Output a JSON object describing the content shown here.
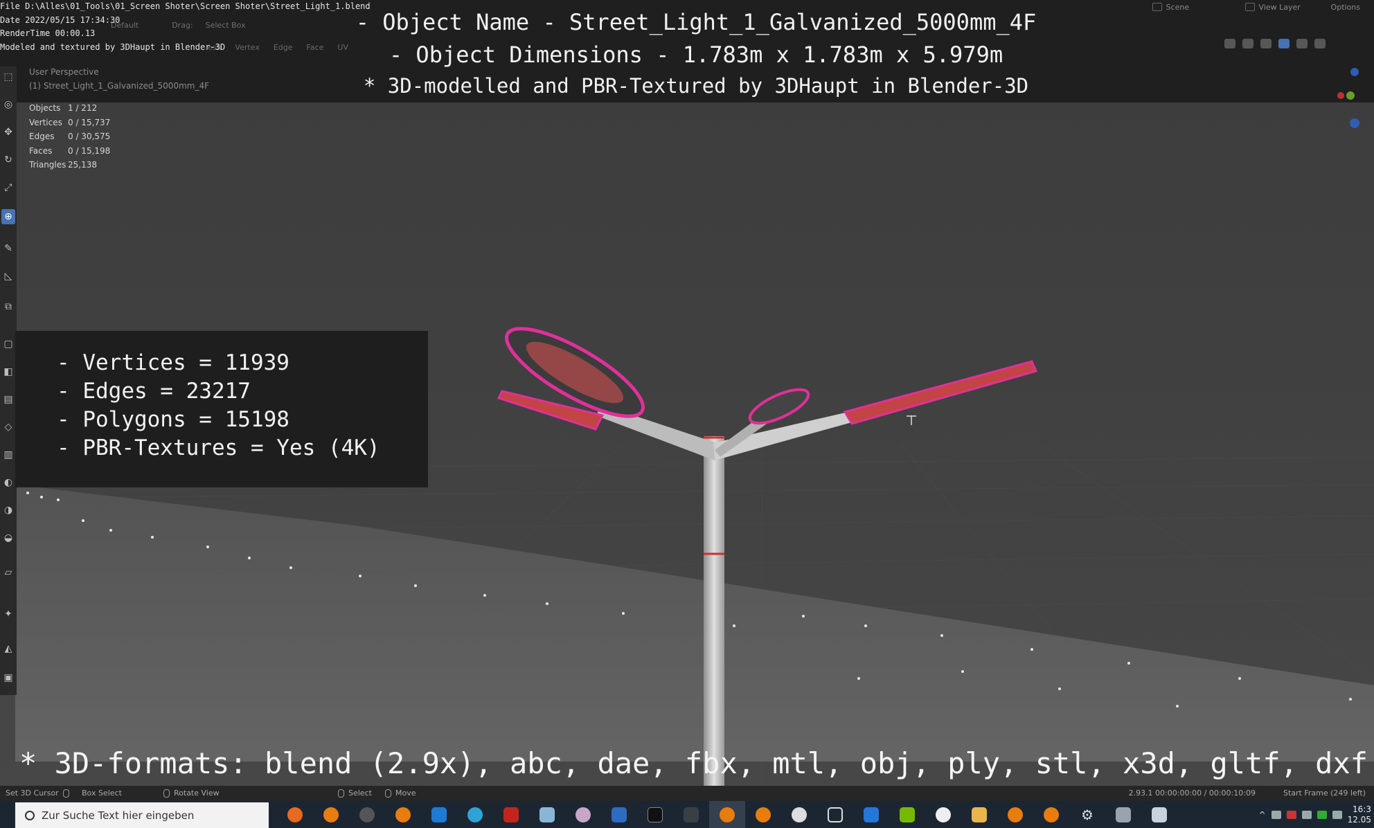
{
  "info": {
    "file_line": "File D:\\Alles\\01_Tools\\01_Screen Shoter\\Screen Shoter\\Street_Light_1.blend",
    "date_line": "Date 2022/05/15 17:34:30",
    "rendertime_line": "RenderTime 00:00.13",
    "modeled_line": "Modeled and textured by 3DHaupt in Blender-3D"
  },
  "header": {
    "orientation": "Default",
    "drag_label": "Drag:",
    "drag_value": "Select Box",
    "mesh_label": "esh",
    "vertex": "Vertex",
    "edge": "Edge",
    "face": "Face",
    "uv": "UV",
    "scene": "Scene",
    "view_layer": "View Layer",
    "options": "Options",
    "axes": [
      "X",
      "Y",
      "Z"
    ]
  },
  "overlay": {
    "line1": "- Object Name - Street_Light_1_Galvanized_5000mm_4F",
    "line2": "- Object Dimensions -  1.783m x 1.783m x 5.979m",
    "line3": "* 3D-modelled and PBR-Textured by 3DHaupt in Blender-3D"
  },
  "viewport": {
    "perspective": "User Perspective",
    "object": "(1) Street_Light_1_Galvanized_5000mm_4F"
  },
  "stats": [
    {
      "key": "Objects",
      "value": "1 / 212"
    },
    {
      "key": "Vertices",
      "value": "0 / 15,737"
    },
    {
      "key": "Edges",
      "value": "0 / 30,575"
    },
    {
      "key": "Faces",
      "value": "0 / 15,198"
    },
    {
      "key": "Triangles",
      "value": "25,138"
    }
  ],
  "polycount": {
    "vertices": "- Vertices = 11939",
    "edges": "- Edges = 23217",
    "polygons": "- Polygons = 15198",
    "textures": "- PBR-Textures =  Yes (4K)"
  },
  "formats_line": "* 3D-formats: blend (2.9x), abc, dae, fbx, mtl, obj, ply, stl, x3d, gltf, dxf",
  "statusbar": {
    "set_cursor": "Set 3D Cursor",
    "box_select": "Box Select",
    "rotate_view": "Rotate View",
    "select": "Select",
    "move": "Move",
    "version": "2.93.1  00:00:00:00 / 00:00:10:09",
    "start_frame": "Start Frame (249 left)"
  },
  "taskbar": {
    "search_placeholder": "Zur Suche Text hier eingeben",
    "time": "16:3",
    "date": "12.05"
  },
  "colors": {
    "accent": "#4772b3",
    "wire_highlight": "#e0309a",
    "wire_red": "#d22d2d"
  }
}
